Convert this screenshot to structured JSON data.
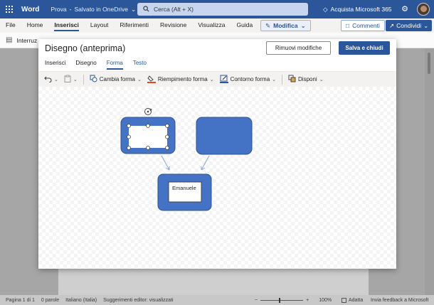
{
  "app": {
    "name": "Word",
    "document_title": "Prova",
    "save_state": "Salvato in OneDrive",
    "search_placeholder": "Cerca (Alt + X)",
    "buy_label": "Acquista Microsoft 365"
  },
  "ribbon": {
    "tabs": [
      "File",
      "Home",
      "Inserisci",
      "Layout",
      "Riferimenti",
      "Revisione",
      "Visualizza",
      "Guida"
    ],
    "active_tab": "Inserisci",
    "edit_mode": "Modifica",
    "comments_label": "Commenti",
    "share_label": "Condividi",
    "partial_command": "Interruz"
  },
  "dialog": {
    "title": "Disegno (anteprima)",
    "discard_label": "Rimuovi modifiche",
    "save_label": "Salva e chiudi",
    "tabs": [
      "Inserisci",
      "Disegno",
      "Forma",
      "Testo"
    ],
    "active_tab": "Forma",
    "tools": {
      "change_shape": "Cambia forma",
      "shape_fill": "Riempimento forma",
      "shape_outline": "Contorno forma",
      "arrange": "Disponi"
    },
    "shape_text": "Emanuele",
    "colors": {
      "shape_fill": "#4472c4",
      "accent": "#2b579a",
      "fill_swatch": "#d94a2a"
    }
  },
  "statusbar": {
    "page": "Pagina 1 di 1",
    "words": "0 parole",
    "language": "Italiano (Italia)",
    "editor": "Suggerimenti editor: visualizzati",
    "zoom": "100%",
    "fit": "Adatta",
    "feedback": "Invia feedback a Microsoft"
  }
}
